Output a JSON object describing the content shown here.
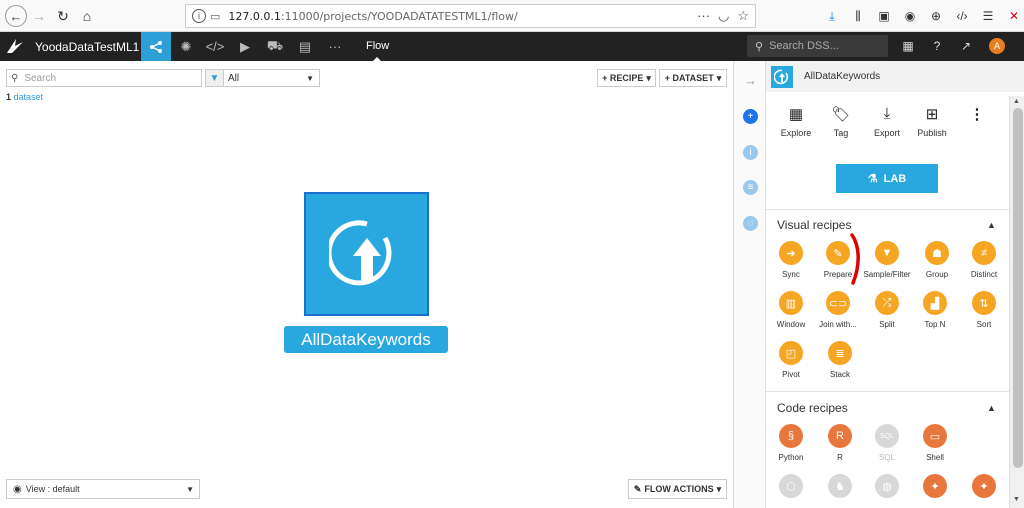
{
  "browser": {
    "url_host": "127.0.0.1",
    "url_path": ":11000/projects/YOODADATATESTML1/flow/"
  },
  "header": {
    "project_name": "YoodaDataTestML1",
    "flow_label": "Flow",
    "search_placeholder": "Search DSS...",
    "avatar_letter": "A"
  },
  "flow": {
    "search_placeholder": "Search",
    "filter_value": "All",
    "recipe_button": "+ RECIPE",
    "dataset_button": "+ DATASET",
    "count_number": "1",
    "count_label": "dataset",
    "node_label": "AllDataKeywords",
    "view_label": "View : default",
    "flow_actions": "FLOW ACTIONS"
  },
  "panel": {
    "dataset_name": "AllDataKeywords",
    "actions": [
      {
        "label": "Explore",
        "icon": "table-icon"
      },
      {
        "label": "Tag",
        "icon": "tag-icon"
      },
      {
        "label": "Export",
        "icon": "download-icon"
      },
      {
        "label": "Publish",
        "icon": "publish-icon"
      }
    ],
    "lab_label": "LAB",
    "visual_title": "Visual recipes",
    "visual_recipes": [
      {
        "label": "Sync",
        "icon": "arrow-right-icon"
      },
      {
        "label": "Prepare",
        "icon": "broom-icon"
      },
      {
        "label": "Sample/Filter",
        "icon": "funnel-icon"
      },
      {
        "label": "Group",
        "icon": "group-icon"
      },
      {
        "label": "Distinct",
        "icon": "not-equal-icon"
      },
      {
        "label": "Window",
        "icon": "window-icon"
      },
      {
        "label": "Join with...",
        "icon": "join-icon"
      },
      {
        "label": "Split",
        "icon": "split-icon"
      },
      {
        "label": "Top N",
        "icon": "top-n-icon"
      },
      {
        "label": "Sort",
        "icon": "sort-icon"
      },
      {
        "label": "Pivot",
        "icon": "pivot-icon"
      },
      {
        "label": "Stack",
        "icon": "stack-icon"
      }
    ],
    "code_title": "Code recipes",
    "code_recipes": [
      {
        "label": "Python",
        "icon": "python-icon"
      },
      {
        "label": "R",
        "icon": "r-icon"
      },
      {
        "label": "SQL",
        "icon": "sql-icon"
      },
      {
        "label": "Shell",
        "icon": "shell-icon"
      }
    ]
  },
  "colors": {
    "accent": "#29a8e0",
    "recipe_orange": "#f6a623",
    "code_orange": "#e8773e",
    "header_bg": "#222222"
  }
}
